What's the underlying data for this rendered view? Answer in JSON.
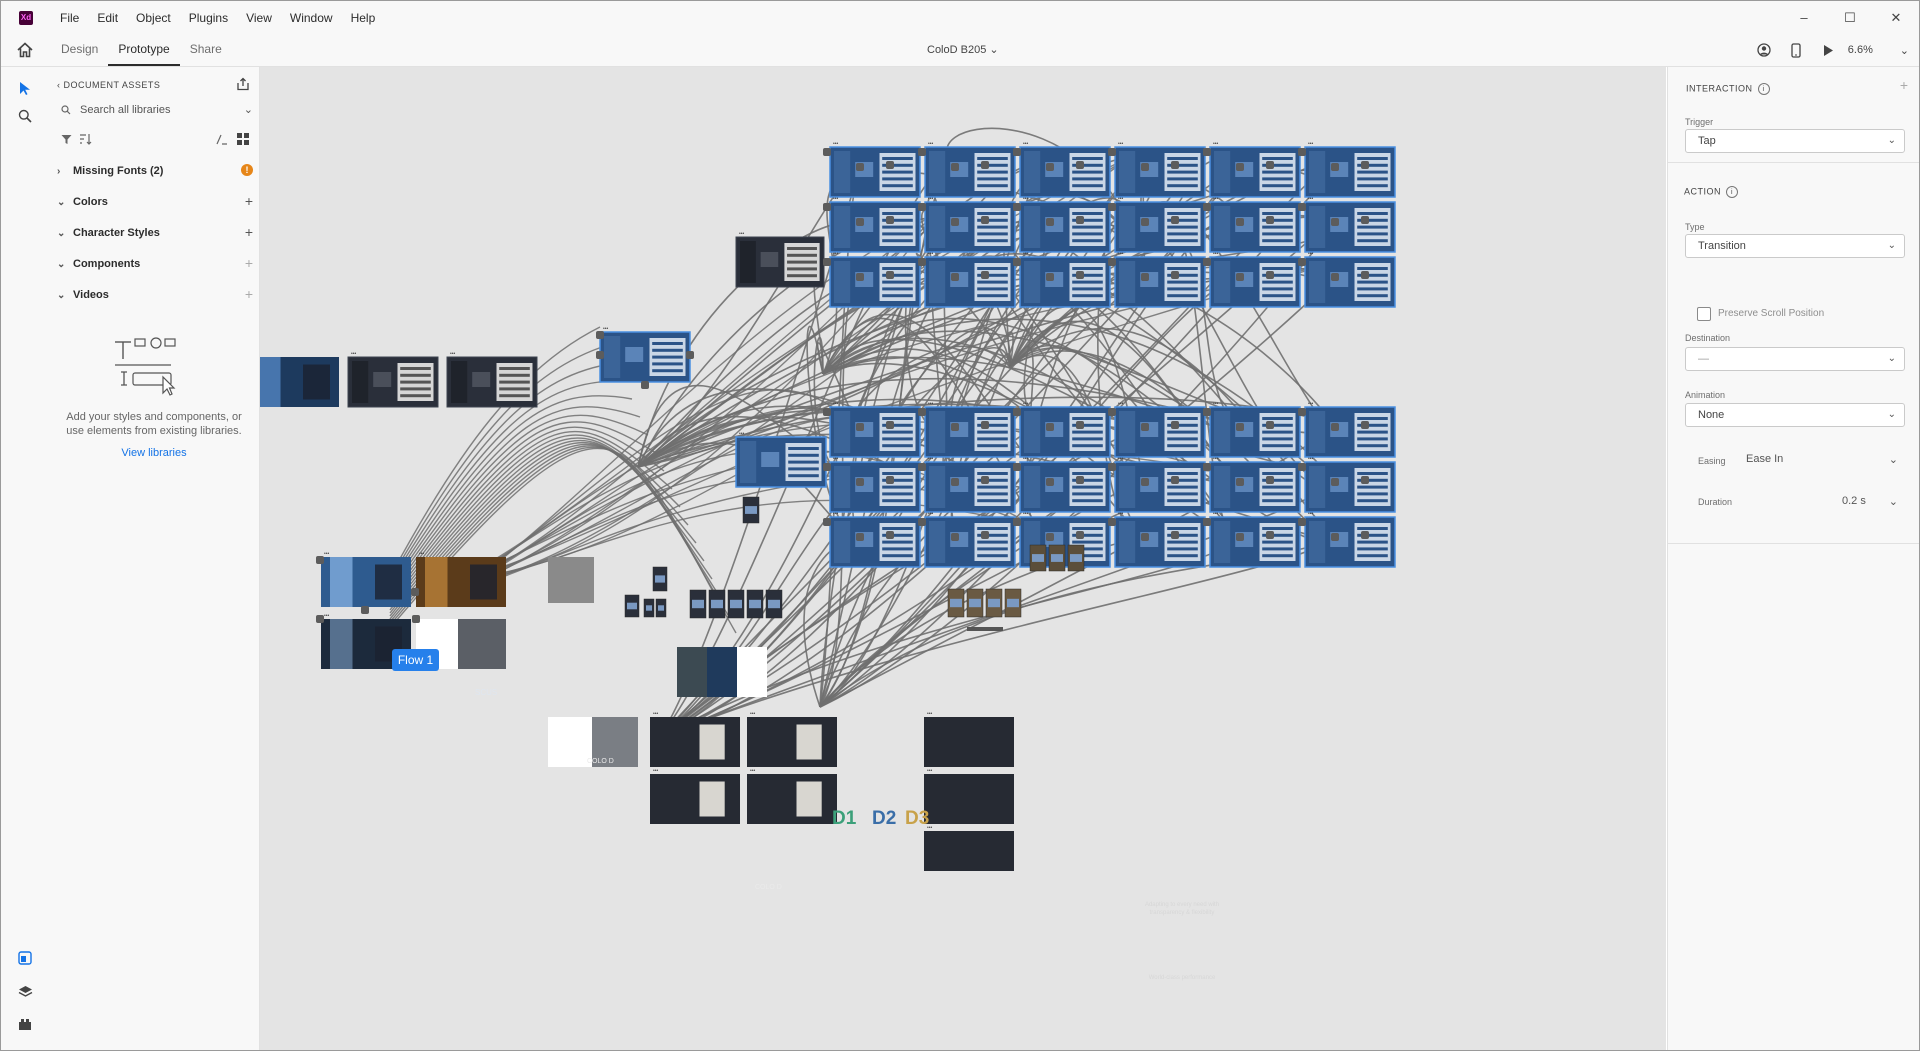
{
  "app": {
    "logo": "Xd",
    "brand_color": "#470137"
  },
  "menu": [
    "File",
    "Edit",
    "Object",
    "Plugins",
    "View",
    "Window",
    "Help"
  ],
  "window_controls": {
    "minimize": "–",
    "maximize": "☐",
    "close": "✕"
  },
  "modebar": {
    "tabs": [
      "Design",
      "Prototype",
      "Share"
    ],
    "active_tab": "Prototype",
    "document_title": "ColoD B205",
    "zoom": "6.6%"
  },
  "assets_panel": {
    "header": "DOCUMENT ASSETS",
    "search_placeholder": "Search all libraries",
    "sections": [
      {
        "label": "Missing Fonts (2)",
        "expanded": false
      },
      {
        "label": "Colors",
        "expanded": true
      },
      {
        "label": "Character Styles",
        "expanded": true
      },
      {
        "label": "Components",
        "expanded": true
      },
      {
        "label": "Videos",
        "expanded": true
      }
    ],
    "empty_message": "Add your styles and components, or use elements from existing libraries.",
    "view_libraries_link": "View libraries"
  },
  "canvas": {
    "flow_label": "Flow 1",
    "artboard_labels": {
      "d1": "D1",
      "d2": "D2",
      "d3": "D3",
      "slide_a": "Adapting to every need with transparency & flexibility",
      "slide_b": "World-class performance",
      "colo": "COLO D",
      "scus": "SCUS"
    },
    "colors": {
      "selected_artboard": "#2b5387",
      "link_wire": "#6f6f6f",
      "flow_badge": "#2680eb"
    }
  },
  "properties_panel": {
    "interaction_title": "INTERACTION",
    "trigger_label": "Trigger",
    "trigger_value": "Tap",
    "action_title": "ACTION",
    "type_label": "Type",
    "type_value": "Transition",
    "preserve_scroll_label": "Preserve Scroll Position",
    "preserve_scroll_checked": false,
    "destination_label": "Destination",
    "destination_value": "—",
    "animation_label": "Animation",
    "animation_value": "None",
    "easing_label": "Easing",
    "easing_value": "Ease In",
    "duration_label": "Duration",
    "duration_value": "0.2 s"
  }
}
